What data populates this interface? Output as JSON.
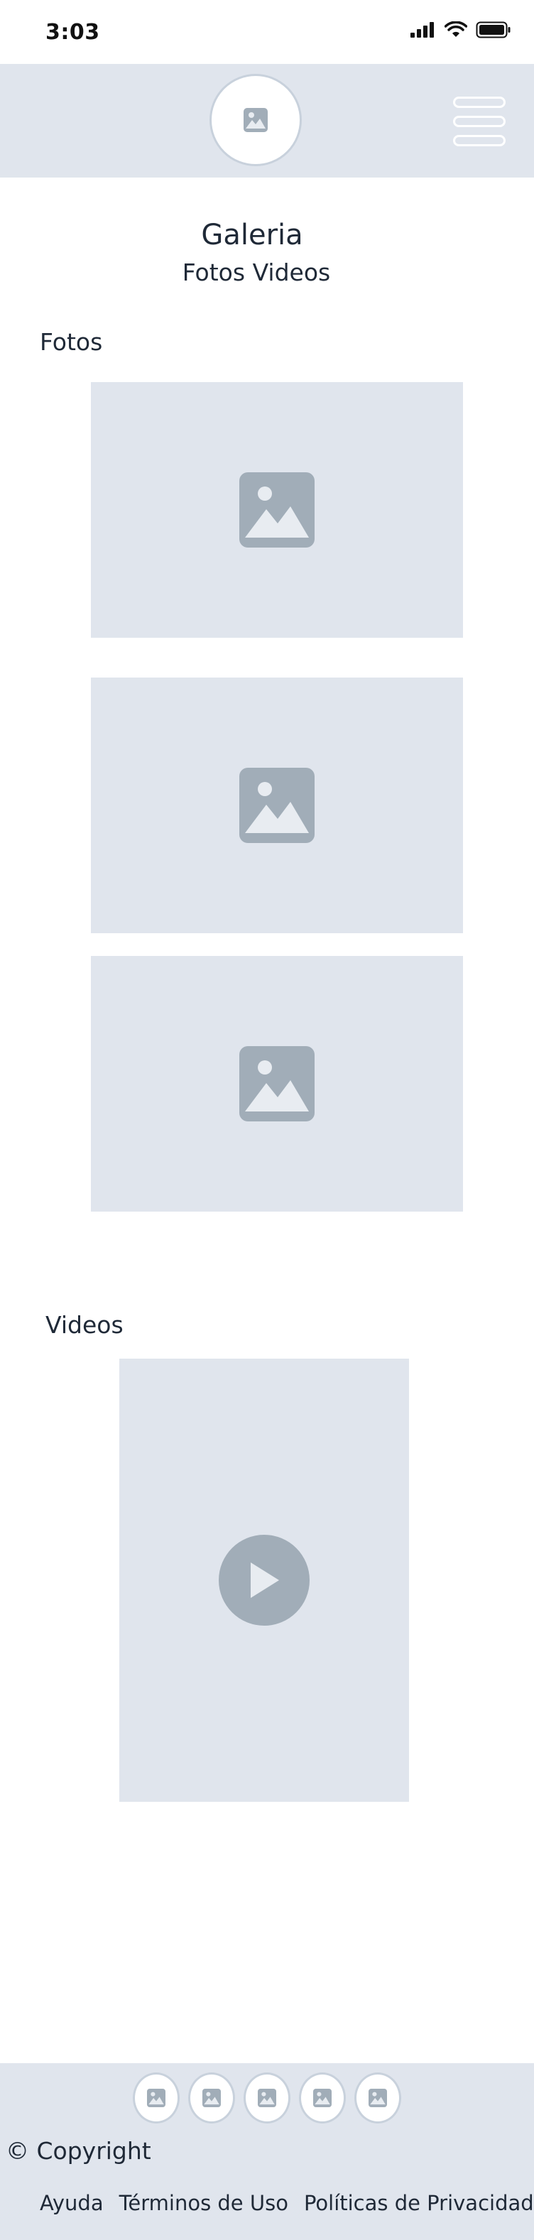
{
  "status_bar": {
    "time": "3:03"
  },
  "header": {
    "logo_icon": "image-placeholder-icon",
    "menu_icon": "hamburger-menu-icon"
  },
  "gallery": {
    "title": "Galeria",
    "tab_photos": "Fotos",
    "tab_videos": "Videos"
  },
  "photos_section": {
    "title": "Fotos",
    "items": [
      "image-placeholder-icon",
      "image-placeholder-icon",
      "image-placeholder-icon"
    ]
  },
  "videos_section": {
    "title": "Videos",
    "items": [
      "play-icon"
    ]
  },
  "footer": {
    "social_icons": [
      "image-placeholder-icon",
      "image-placeholder-icon",
      "image-placeholder-icon",
      "image-placeholder-icon",
      "image-placeholder-icon"
    ],
    "copyright": "© Copyright",
    "links": {
      "help": "Ayuda",
      "terms": "Términos de Uso",
      "privacy": "Políticas de Privacidad"
    }
  },
  "colors": {
    "placeholder_bg": "#e0e5ed",
    "icon_gray": "#a1adb8",
    "text": "#1f2937"
  }
}
